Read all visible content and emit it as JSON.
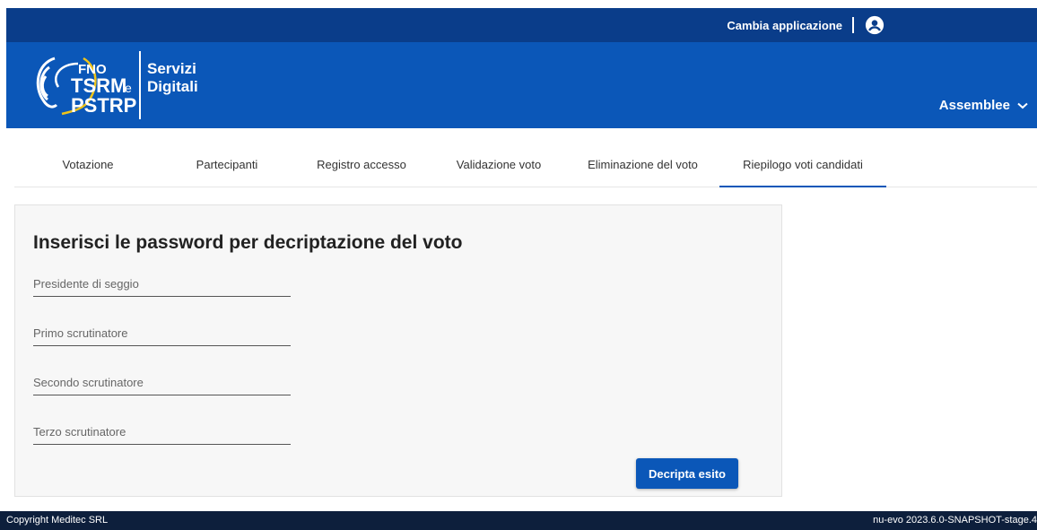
{
  "topbar": {
    "switch_app_label": "Cambia applicazione"
  },
  "header": {
    "logo_text": [
      "FNO",
      "TSRM",
      "e",
      "PSTRP"
    ],
    "brand_line1": "Servizi",
    "brand_line2": "Digitali",
    "menu_label": "Assemblee"
  },
  "tabs": [
    {
      "label": "Votazione"
    },
    {
      "label": "Partecipanti"
    },
    {
      "label": "Registro accesso"
    },
    {
      "label": "Validazione voto"
    },
    {
      "label": "Eliminazione del voto"
    },
    {
      "label": "Riepilogo voti candidati",
      "active": true
    }
  ],
  "form": {
    "title": "Inserisci le password per decriptazione del voto",
    "fields": [
      {
        "placeholder": "Presidente di seggio",
        "value": ""
      },
      {
        "placeholder": "Primo scrutinatore",
        "value": ""
      },
      {
        "placeholder": "Secondo scrutinatore",
        "value": ""
      },
      {
        "placeholder": "Terzo scrutinatore",
        "value": ""
      }
    ],
    "submit_label": "Decripta esito"
  },
  "footer": {
    "copyright": "Copyright Meditec SRL",
    "version": "nu-evo 2023.6.0-SNAPSHOT-stage.4"
  },
  "colors": {
    "topbar": "#0a3d8a",
    "header": "#0b57b8",
    "accent": "#0b57b8",
    "footer": "#0d1f3c"
  },
  "icons": {
    "user": "user-circle-icon",
    "menu_chevron": "chevron-down-icon"
  }
}
